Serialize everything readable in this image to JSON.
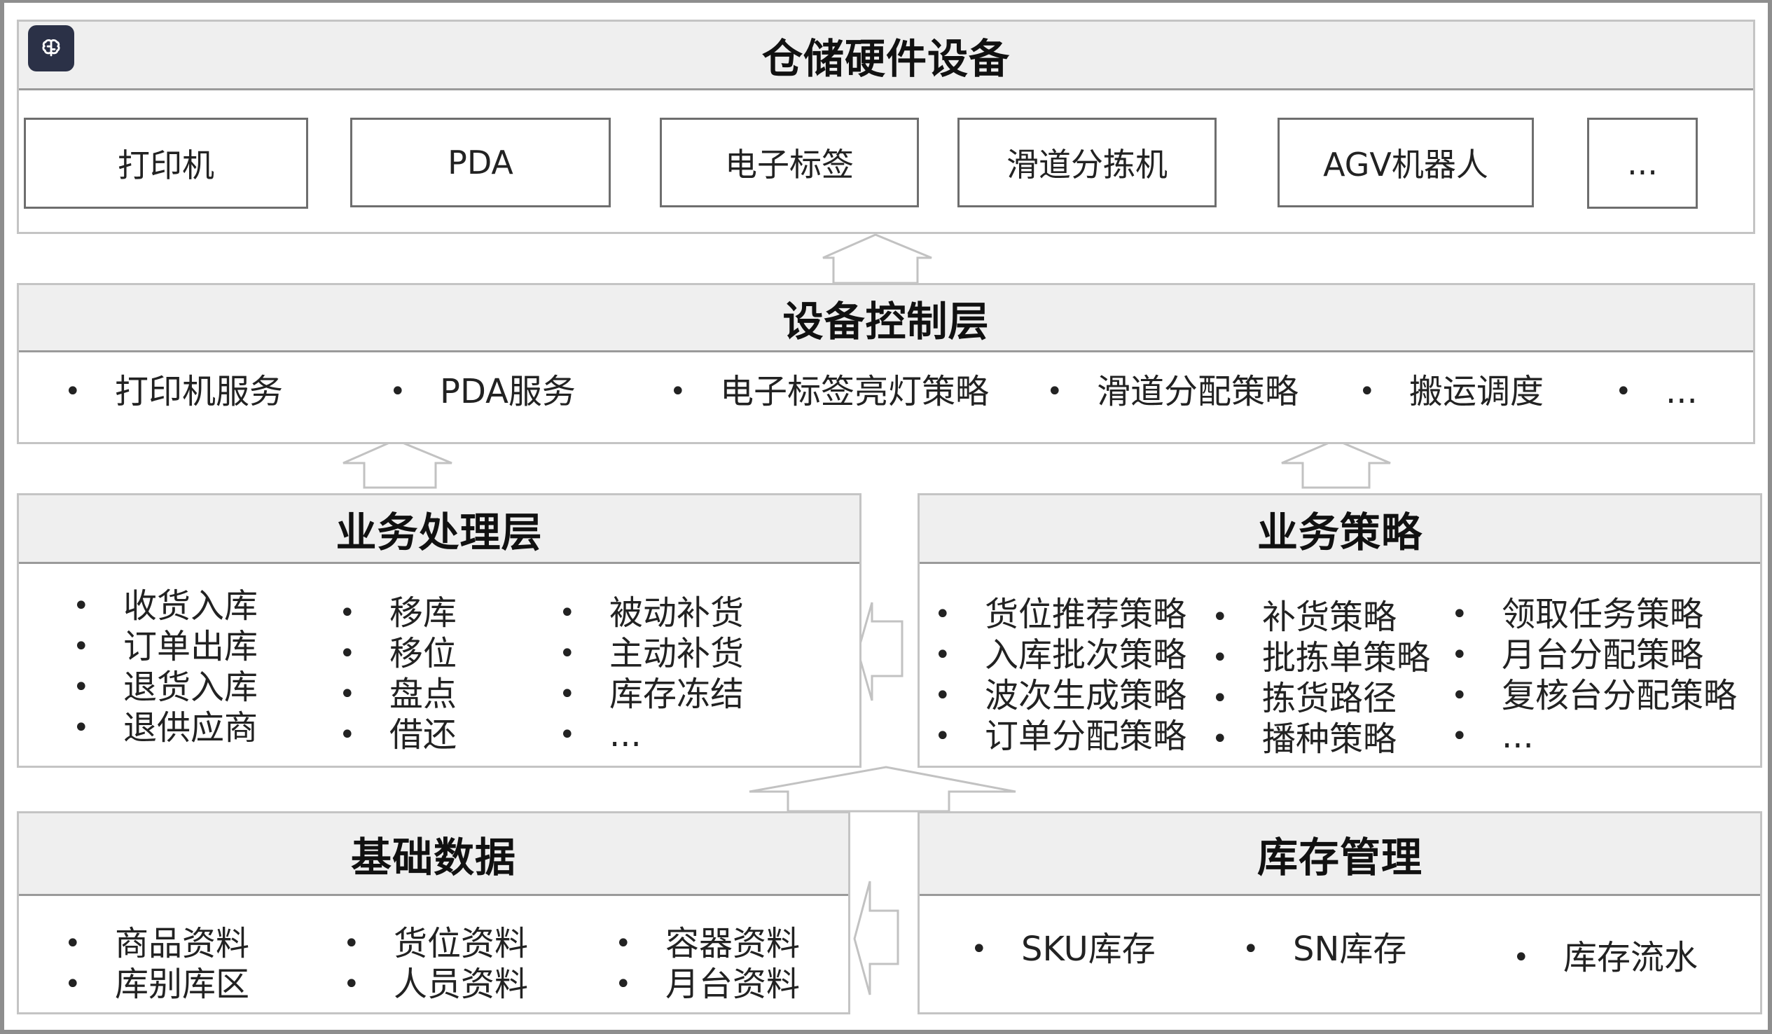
{
  "hardware": {
    "title": "仓储硬件设备",
    "devices": [
      "打印机",
      "PDA",
      "电子标签",
      "滑道分拣机",
      "AGV机器人",
      "..."
    ]
  },
  "control": {
    "title": "设备控制层",
    "items": [
      "打印机服务",
      "PDA服务",
      "电子标签亮灯策略",
      "滑道分配策略",
      "搬运调度",
      "..."
    ]
  },
  "processing": {
    "title": "业务处理层",
    "col1": [
      "收货入库",
      "订单出库",
      "退货入库",
      "退供应商"
    ],
    "col2": [
      "移库",
      "移位",
      "盘点",
      "借还"
    ],
    "col3": [
      "被动补货",
      "主动补货",
      "库存冻结",
      "..."
    ]
  },
  "strategy": {
    "title": "业务策略",
    "col1": [
      "货位推荐策略",
      "入库批次策略",
      "波次生成策略",
      "订单分配策略"
    ],
    "col2": [
      "补货策略",
      "批拣单策略",
      "拣货路径",
      "播种策略"
    ],
    "col3": [
      "领取任务策略",
      "月台分配策略",
      "复核台分配策略",
      "..."
    ]
  },
  "basic": {
    "title": "基础数据",
    "col1": [
      "商品资料",
      "库别库区"
    ],
    "col2": [
      "货位资料",
      "人员资料"
    ],
    "col3": [
      "容器资料",
      "月台资料"
    ]
  },
  "inventory": {
    "title": "库存管理",
    "items": [
      "SKU库存",
      "SN库存",
      "库存流水"
    ]
  }
}
